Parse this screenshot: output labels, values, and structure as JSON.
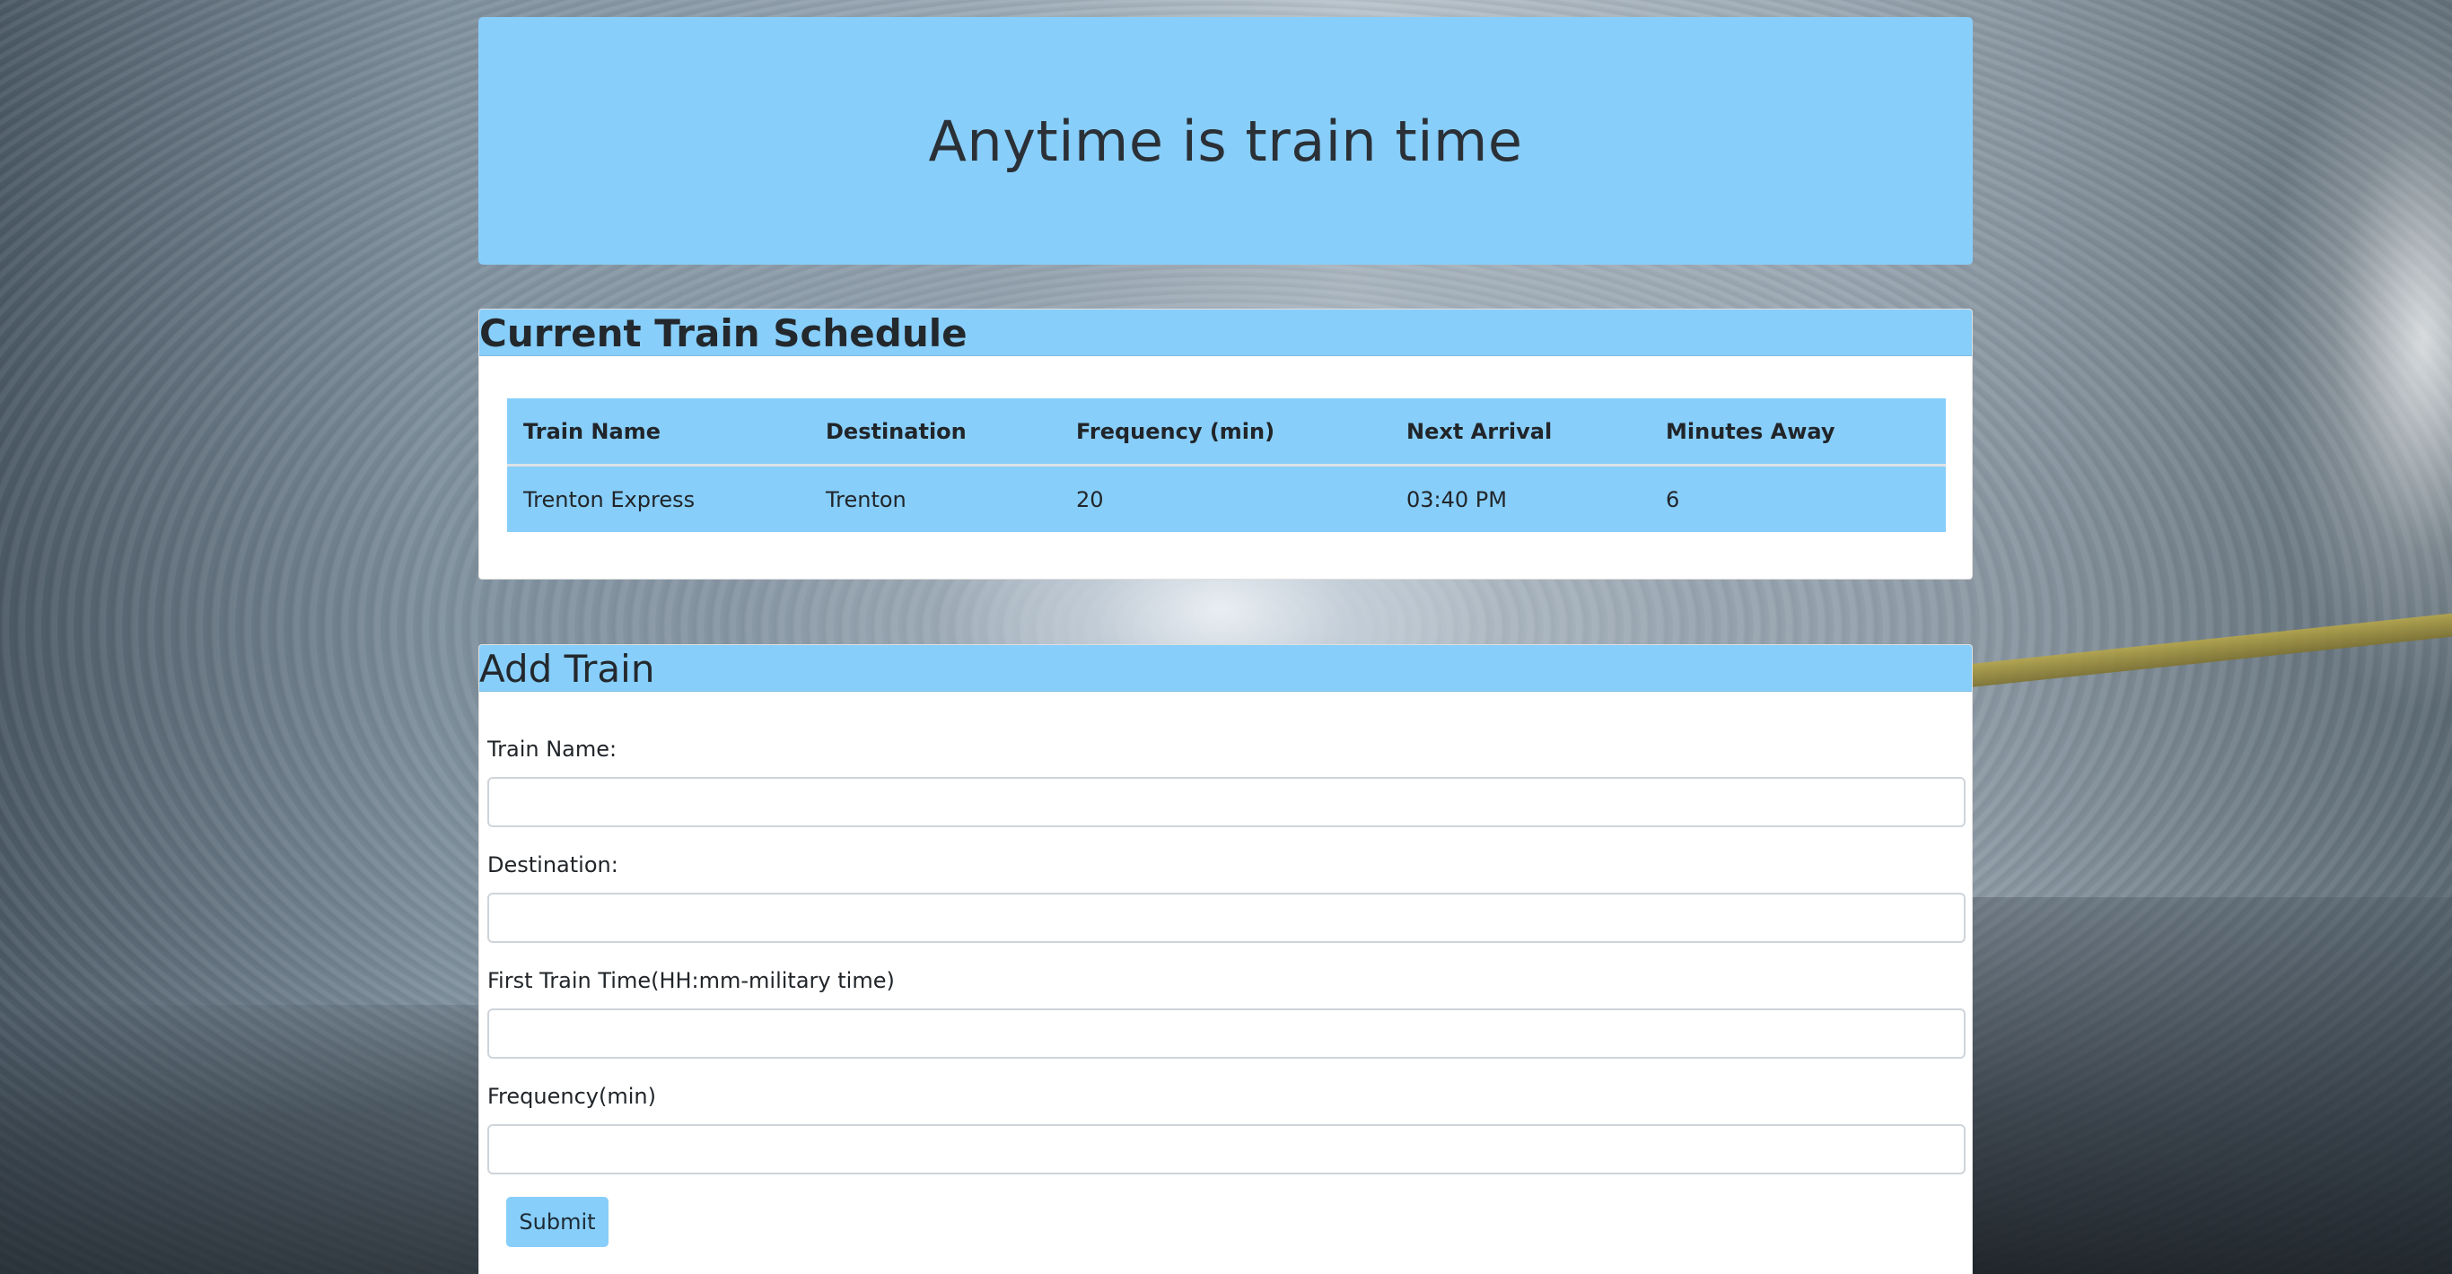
{
  "header": {
    "title": "Anytime is train time"
  },
  "schedule": {
    "title": "Current Train Schedule",
    "columns": [
      "Train Name",
      "Destination",
      "Frequency (min)",
      "Next Arrival",
      "Minutes Away"
    ],
    "rows": [
      [
        "Trenton Express",
        "Trenton",
        "20",
        "03:40 PM",
        "6"
      ]
    ]
  },
  "add_train": {
    "title": "Add Train",
    "fields": [
      {
        "label": "Train Name:",
        "value": ""
      },
      {
        "label": "Destination:",
        "value": ""
      },
      {
        "label": "First Train Time(HH:mm-military time)",
        "value": ""
      },
      {
        "label": "Frequency(min)",
        "value": ""
      }
    ],
    "submit_label": "Submit"
  },
  "colors": {
    "accent": "#87cefa",
    "card_background": "#ffffff",
    "text": "#212529"
  }
}
